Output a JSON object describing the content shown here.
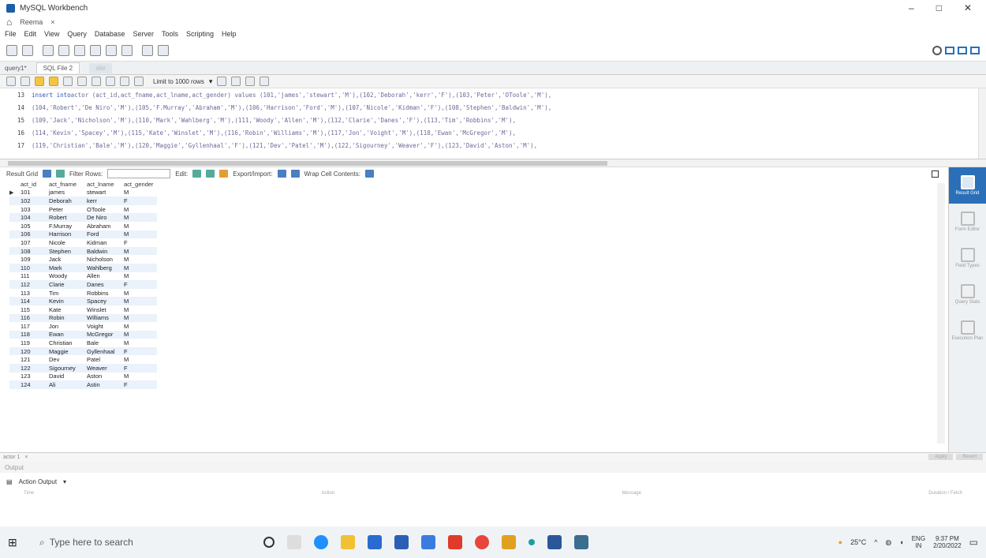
{
  "window": {
    "title": "MySQL Workbench",
    "controls": [
      "–",
      "□",
      "✕"
    ]
  },
  "conn_tab": "Reema",
  "menu": [
    "File",
    "Edit",
    "View",
    "Query",
    "Database",
    "Server",
    "Tools",
    "Scripting",
    "Help"
  ],
  "query_tabs": [
    "query1*",
    "SQL File 2",
    "site"
  ],
  "limit": "Limit to 1000 rows",
  "editor_lines": [
    {
      "num": "13",
      "kw": "insert into",
      "code": " actor (act_id,act_fname,act_lname,act_gender) values (101,'james','stewart','M'),(102,'Deborah','kerr','F'),(103,'Peter','OToole','M'),"
    },
    {
      "num": "14",
      "kw": "",
      "code": "(104,'Robert','De Niro','M'),(105,'F.Murray','Abraham','M'),(106,'Harrison','Ford','M'),(107,'Nicole','Kidman','F'),(108,'Stephen','Baldwin','M'),"
    },
    {
      "num": "15",
      "kw": "",
      "code": "(109,'Jack','Nicholson','M'),(110,'Mark','Wahlberg','M'),(111,'Woody','Allen','M'),(112,'Clarie','Danes','F'),(113,'Tim','Robbins','M'),"
    },
    {
      "num": "16",
      "kw": "",
      "code": "(114,'Kevin','Spacey','M'),(115,'Kate','Winslet','M'),(116,'Robin','Williams','M'),(117,'Jon','Voight','M'),(118,'Ewan','McGregor','M'),"
    },
    {
      "num": "17",
      "kw": "",
      "code": "(119,'Christian','Bale','M'),(120,'Maggie','Gyllenhaal','F'),(121,'Dev','Patel','M'),(122,'Sigourney','Weaver','F'),(123,'David','Aston','M'),"
    }
  ],
  "result_toolbar": {
    "result_grid": "Result Grid",
    "filter": "Filter Rows:",
    "edit": "Edit:",
    "export": "Export/Import:",
    "wrap": "Wrap Cell Contents:"
  },
  "grid": {
    "headers": [
      "act_id",
      "act_fname",
      "act_lname",
      "act_gender"
    ],
    "rows": [
      [
        "101",
        "james",
        "stewart",
        "M"
      ],
      [
        "102",
        "Deborah",
        "kerr",
        "F"
      ],
      [
        "103",
        "Peter",
        "OToole",
        "M"
      ],
      [
        "104",
        "Robert",
        "De Niro",
        "M"
      ],
      [
        "105",
        "F.Murray",
        "Abraham",
        "M"
      ],
      [
        "106",
        "Harrison",
        "Ford",
        "M"
      ],
      [
        "107",
        "Nicole",
        "Kidman",
        "F"
      ],
      [
        "108",
        "Stephen",
        "Baldwin",
        "M"
      ],
      [
        "109",
        "Jack",
        "Nicholson",
        "M"
      ],
      [
        "110",
        "Mark",
        "Wahlberg",
        "M"
      ],
      [
        "111",
        "Woody",
        "Allen",
        "M"
      ],
      [
        "112",
        "Clarie",
        "Danes",
        "F"
      ],
      [
        "113",
        "Tim",
        "Robbins",
        "M"
      ],
      [
        "114",
        "Kevin",
        "Spacey",
        "M"
      ],
      [
        "115",
        "Kate",
        "Winslet",
        "M"
      ],
      [
        "116",
        "Robin",
        "Williams",
        "M"
      ],
      [
        "117",
        "Jon",
        "Voight",
        "M"
      ],
      [
        "118",
        "Ewan",
        "McGregor",
        "M"
      ],
      [
        "119",
        "Christian",
        "Bale",
        "M"
      ],
      [
        "120",
        "Maggie",
        "Gyllenhaal",
        "F"
      ],
      [
        "121",
        "Dev",
        "Patel",
        "M"
      ],
      [
        "122",
        "Sigourney",
        "Weaver",
        "F"
      ],
      [
        "123",
        "David",
        "Aston",
        "M"
      ],
      [
        "124",
        "Ali",
        "Astin",
        "F"
      ]
    ]
  },
  "side": [
    "Result Grid",
    "Form Editor",
    "Field Types",
    "Query Stats",
    "Execution Plan"
  ],
  "bottom_tab": "actor 1",
  "apply": "Apply",
  "revert": "Revert",
  "output": "Output",
  "action_output": "Action Output",
  "out_cols": [
    "Time",
    "Action",
    "Message",
    "Duration / Fetch"
  ],
  "taskbar": {
    "search": "Type here to search",
    "weather": "25°C",
    "lang": "ENG",
    "region": "IN",
    "time": "9:37 PM",
    "date": "2/20/2022"
  }
}
